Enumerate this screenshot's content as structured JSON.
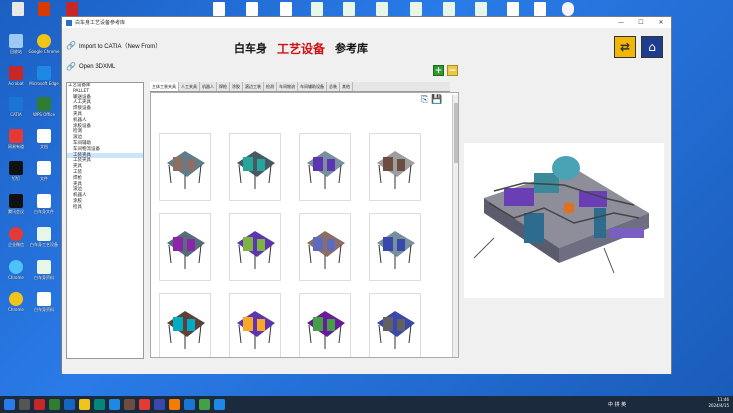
{
  "window": {
    "title": "白车身工艺设备参考库"
  },
  "links": {
    "import_catia": "Import to CATIA（New From）",
    "open_3dxml": "Open 3DXML"
  },
  "heading": {
    "part1": "白车身",
    "part2": "工艺设备",
    "part3": "参考库"
  },
  "buttons": {
    "arrow_icon": "swap-arrow-icon",
    "home_icon": "home-icon",
    "plus": "+",
    "minus": "−"
  },
  "tree": {
    "root": "工艺设备库",
    "items": [
      "PALLET",
      "输送设备",
      "人工夹具",
      "焊接设备",
      "夹具",
      "机器人",
      "涂胶设备",
      "检测",
      "滚边",
      "车间辅助",
      "车间物流设备",
      "工装夹具",
      "工装夹具",
      "夹具",
      "工装",
      "焊枪",
      "夹具",
      "滚边",
      "机器人",
      "涂胶",
      "检具"
    ],
    "selected_index": 11
  },
  "tabs": [
    "主体工装夹具",
    "人工夹具",
    "机器人",
    "焊枪",
    "涂胶",
    "滚边工装",
    "检测",
    "车间物流",
    "车间辅助设备",
    "总装",
    "其他"
  ],
  "desktop_icons": [
    {
      "label": "回收站"
    },
    {
      "label": "Google Chrome"
    },
    {
      "label": "Acrobat"
    },
    {
      "label": "Microsoft Edge"
    },
    {
      "label": "CATIA"
    },
    {
      "label": "WPS Office"
    },
    {
      "label": "网易有道"
    },
    {
      "label": "文档"
    },
    {
      "label": "钉钉"
    },
    {
      "label": "文件"
    },
    {
      "label": "腾讯会议"
    },
    {
      "label": "白车身文件"
    },
    {
      "label": "企业微信"
    },
    {
      "label": "白车身工艺设备"
    },
    {
      "label": "Chrome"
    },
    {
      "label": "白车身资料"
    }
  ],
  "taskbar": {
    "tray_text": "中 拼 英",
    "time": "11:46",
    "date": "2024/4/15"
  }
}
